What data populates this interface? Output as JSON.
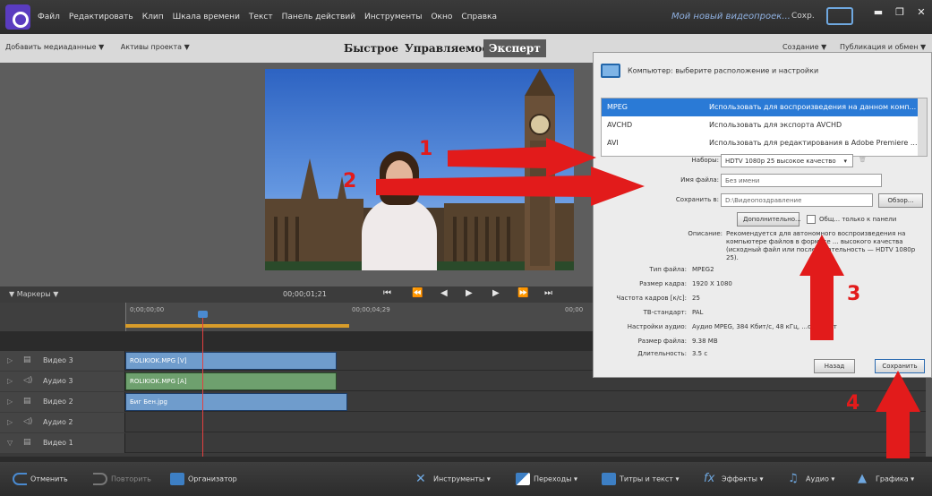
{
  "menubar": {
    "items": [
      "Файл",
      "Редактировать",
      "Клип",
      "Шкала времени",
      "Текст",
      "Панель действий",
      "Инструменты",
      "Окно",
      "Справка"
    ],
    "project_name": "Мой новый видеопроек...",
    "save_label": "Сохр."
  },
  "toolbar2": {
    "add_media": "Добавить медиаданные ▼",
    "project_assets": "Активы проекта ▼",
    "modes": [
      "Быстрое",
      "Управляемое",
      "Эксперт"
    ],
    "active_mode": "Эксперт",
    "create": "Создание ▼",
    "publish": "Публикация и обмен ▼"
  },
  "timeline": {
    "markers_label": "▼ Маркеры ▼",
    "current_timecode": "00;00;01;21",
    "ruler_codes": [
      "0;00;00;00",
      "00;00;04;29",
      "00;00"
    ],
    "tracks": [
      {
        "type": "video",
        "name": "Видео 3"
      },
      {
        "type": "audio",
        "name": "Аудио 3"
      },
      {
        "type": "video",
        "name": "Видео 2"
      },
      {
        "type": "audio",
        "name": "Аудио 2"
      },
      {
        "type": "video",
        "name": "Видео 1"
      }
    ],
    "clips": [
      {
        "track": 0,
        "label": "ROLIKIOK.MPG [V]",
        "kind": "video"
      },
      {
        "track": 1,
        "label": "ROLIKIOK.MPG [A]",
        "kind": "audio"
      },
      {
        "track": 2,
        "label": "Биг Бен.jpg",
        "kind": "image"
      }
    ]
  },
  "bottombar": {
    "undo": "Отменить",
    "redo": "Повторить",
    "organizer": "Организатор",
    "tools": "Инструменты ▾",
    "transitions": "Переходы ▾",
    "titles": "Титры и текст ▾",
    "effects": "Эффекты ▾",
    "audio": "Аудио ▾",
    "graphics": "Графика ▾"
  },
  "export_panel": {
    "header": "Компьютер: выберите расположение и настройки",
    "formats": [
      {
        "name": "MPEG",
        "desc": "Использовать для воспроизведения на данном комп...",
        "selected": true
      },
      {
        "name": "AVCHD",
        "desc": "Использовать для экспорта AVCHD",
        "selected": false
      },
      {
        "name": "AVI",
        "desc": "Использовать для редактирования в Adobe Premiere ...",
        "selected": false
      }
    ],
    "presets_label": "Наборы:",
    "presets_value": "HDTV 1080p 25 высокое качество",
    "filename_label": "Имя файла:",
    "filename_value": "Без имени",
    "saveto_label": "Сохранить в:",
    "saveto_value": "D:\\Видеопоздравление",
    "browse_button": "Обзор...",
    "advanced_button": "Дополнительно...",
    "share_checkbox_label": "Общ... только к панели",
    "description_label": "Описание:",
    "description_value": "Рекомендуется для автономного воспроизведения на компьютере файлов в формате ... высокого качества (исходный файл или последовательность — HDTV 1080p 25).",
    "info": [
      {
        "label": "Тип файла:",
        "value": "MPEG2"
      },
      {
        "label": "Размер кадра:",
        "value": "1920 X 1080"
      },
      {
        "label": "Частота кадров [к/с]:",
        "value": "25"
      },
      {
        "label": "ТВ-стандарт:",
        "value": "PAL"
      },
      {
        "label": "Настройки аудио:",
        "value": "Аудио MPEG, 384 Кбит/с, 48 кГц, ...о, 16 бит"
      },
      {
        "label": "Размер файла:",
        "value": "9.38 MB"
      },
      {
        "label": "Длительность:",
        "value": "3.5 с"
      }
    ],
    "back_button": "Назад",
    "save_button": "Сохранить"
  },
  "annotations": [
    "1",
    "2",
    "3",
    "4"
  ],
  "colors": {
    "accent_blue": "#2a7ad6",
    "annotation_red": "#e21b1b",
    "video_clip": "#6f9ccc",
    "audio_clip": "#6ea06e"
  }
}
